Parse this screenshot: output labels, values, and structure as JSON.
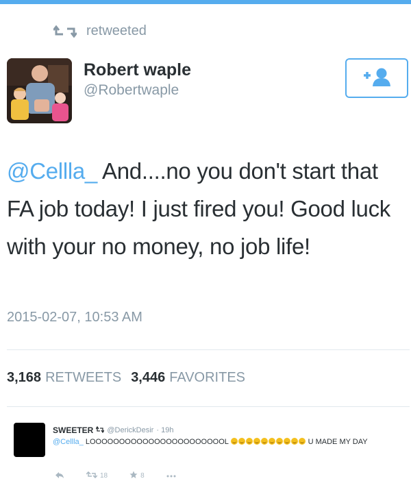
{
  "retweet_banner": {
    "label": "retweeted"
  },
  "author": {
    "name": "Robert waple",
    "handle": "@Robertwaple"
  },
  "tweet": {
    "mention": "@Cellla_",
    "text": " And....no you don't start that FA job today!  I just fired you!  Good luck with your no money, no job life!",
    "timestamp": "2015-02-07, 10:53 AM"
  },
  "stats": {
    "retweets_count": "3,168",
    "retweets_label": "RETWEETS",
    "favorites_count": "3,446",
    "favorites_label": "FAVORITES"
  },
  "reply": {
    "name": "SWEETER",
    "handle": "@DerickDesir",
    "time": "· 19h",
    "mention": "@Cellla_",
    "text_before_emoji": " LOOOOOOOOOOOOOOOOOOOOOOOL",
    "emoji_count": 10,
    "text_after_emoji": " U MADE MY DAY",
    "retweet_count": "18",
    "favorite_count": "8"
  },
  "colors": {
    "accent": "#55acee",
    "muted": "#8899a6",
    "text": "#292f33"
  },
  "icons": [
    "retweet-icon",
    "follow-icon",
    "reply-icon",
    "star-icon",
    "more-icon"
  ]
}
